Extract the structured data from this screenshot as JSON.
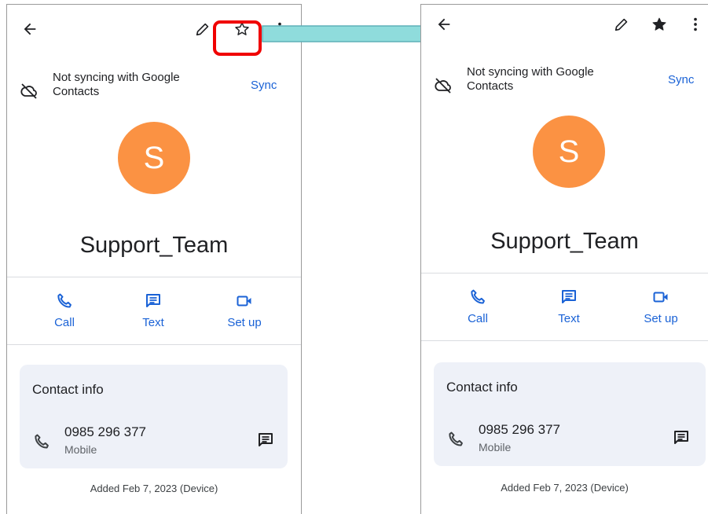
{
  "colors": {
    "accent": "#1a62d6",
    "avatar": "#fb9243",
    "card_bg": "#eef1f8",
    "highlight": "#f00000",
    "arrow_fill": "#8fdcdc",
    "arrow_stroke": "#5fb0b8"
  },
  "before": {
    "icons": {
      "back": "back-arrow-icon",
      "edit": "pencil-icon",
      "favorite": "star-outline-icon",
      "more": "more-vert-icon"
    },
    "sync_notice": "Not syncing with Google Contacts",
    "sync_button": "Sync",
    "avatar_letter": "S",
    "contact_name": "Support_Team",
    "actions": [
      {
        "label": "Call",
        "icon": "phone-icon"
      },
      {
        "label": "Text",
        "icon": "message-icon"
      },
      {
        "label": "Set up",
        "icon": "video-icon"
      }
    ],
    "contact_info_title": "Contact info",
    "phone_number": "0985 296 377",
    "phone_type": "Mobile",
    "added_text": "Added Feb 7, 2023 (Device)"
  },
  "after": {
    "icons": {
      "back": "back-arrow-icon",
      "edit": "pencil-icon",
      "favorite": "star-filled-icon",
      "more": "more-vert-icon"
    },
    "sync_notice": "Not syncing with Google Contacts",
    "sync_button": "Sync",
    "avatar_letter": "S",
    "contact_name": "Support_Team",
    "actions": [
      {
        "label": "Call",
        "icon": "phone-icon"
      },
      {
        "label": "Text",
        "icon": "message-icon"
      },
      {
        "label": "Set up",
        "icon": "video-icon"
      }
    ],
    "contact_info_title": "Contact info",
    "phone_number": "0985 296 377",
    "phone_type": "Mobile",
    "added_text": "Added Feb 7, 2023 (Device)"
  }
}
